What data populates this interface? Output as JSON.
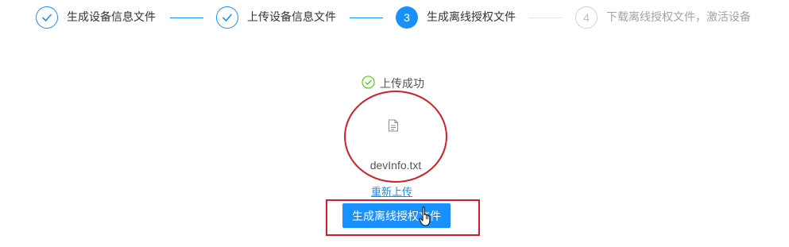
{
  "steps": [
    {
      "number": "1",
      "title": "生成设备信息文件",
      "status": "finished"
    },
    {
      "number": "2",
      "title": "上传设备信息文件",
      "status": "finished"
    },
    {
      "number": "3",
      "title": "生成离线授权文件",
      "status": "active"
    },
    {
      "number": "4",
      "title": "下载离线授权文件，激活设备",
      "status": "waiting"
    }
  ],
  "upload": {
    "status_text": "上传成功",
    "file_name": "devInfo.txt",
    "reupload_label": "重新上传"
  },
  "action": {
    "generate_label": "生成离线授权文件"
  },
  "colors": {
    "primary": "#1890ff",
    "success": "#52c41a",
    "annotation": "#d02027"
  },
  "icons": [
    "check-icon",
    "check-circle-icon",
    "file-icon",
    "hand-cursor-icon"
  ]
}
